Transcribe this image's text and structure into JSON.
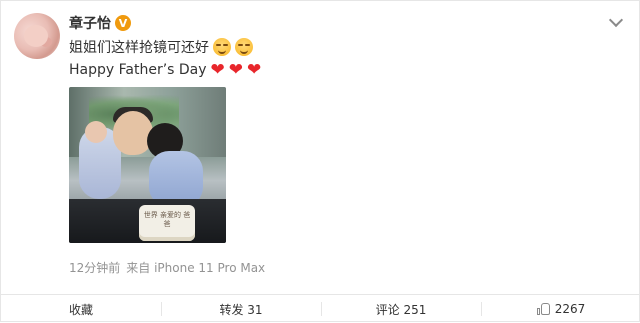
{
  "post": {
    "author": "章子怡",
    "verified_badge": "V",
    "line1": "姐姐们这样抢镜可还好",
    "line2": "Happy Father’s Day",
    "hearts": [
      "❤",
      "❤",
      "❤"
    ],
    "image": {
      "cake_text": "世界 亲爱的 爸爸"
    },
    "time": "12分钟前",
    "source": "来自 iPhone 11 Pro Max"
  },
  "actions": {
    "favorite_label": "收藏",
    "repost_label": "转发 31",
    "comment_label": "评论 251",
    "like_count": "2267"
  },
  "colors": {
    "heart": "#e8262b",
    "verified": "#f09a0e",
    "meta_text": "#939393"
  },
  "icons": {
    "menu": "chevron-down-icon",
    "like": "thumbs-up-icon"
  }
}
